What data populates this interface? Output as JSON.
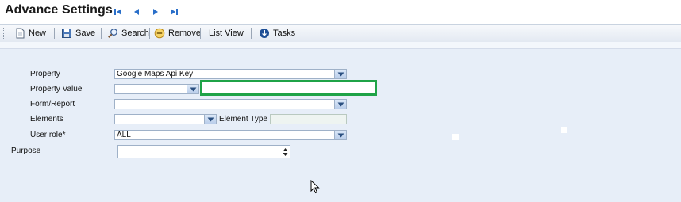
{
  "window": {
    "title": "Advance Settings",
    "nav": [
      "first-record-icon",
      "previous-record-icon",
      "next-record-icon",
      "last-record-icon"
    ]
  },
  "toolbar": {
    "new_label": "New",
    "save_label": "Save",
    "search_label": "Search",
    "remove_label": "Remove",
    "list_view_label": "List View",
    "tasks_label": "Tasks"
  },
  "form": {
    "property": {
      "label": "Property",
      "value": "Google Maps Api Key"
    },
    "property_value": {
      "label": "Property Value",
      "value": ""
    },
    "form_report": {
      "label": "Form/Report",
      "value": ""
    },
    "elements": {
      "label": "Elements",
      "value": ""
    },
    "element_type": {
      "label": "Element Type",
      "value": ""
    },
    "user_role": {
      "label": "User role*",
      "value": "ALL"
    },
    "purpose": {
      "label": "Purpose",
      "value": ""
    }
  },
  "colors": {
    "highlight_border": "#1fa347",
    "content_background": "#e7eef8",
    "nav_arrow": "#2a6fc9"
  }
}
